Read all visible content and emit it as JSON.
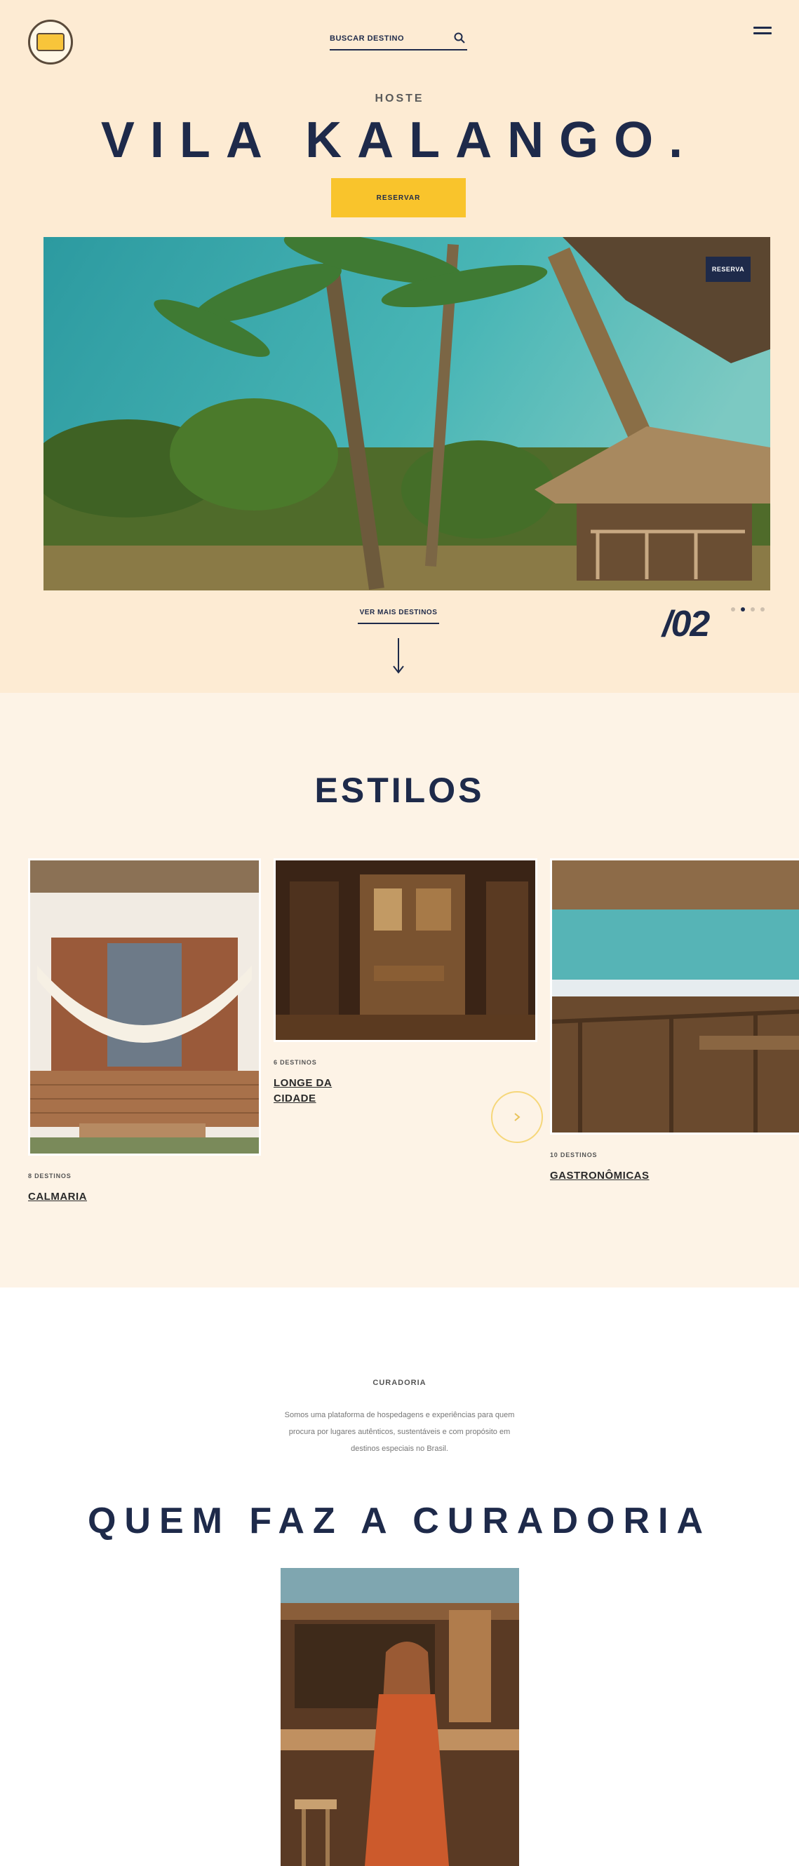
{
  "header": {
    "logo": "Vila Kalango logo",
    "search_placeholder": "BUSCAR DESTINO",
    "search_icon": "search-icon",
    "menu_icon": "hamburger-menu-icon"
  },
  "hero": {
    "eyebrow": "HOSTE",
    "title": "VILA KALANGO.",
    "cta_label": "RESERVAR",
    "photo_badge": "RESERVA",
    "see_more": "VER MAIS DESTINOS",
    "slide_number": "/02",
    "slides_total": 4,
    "slide_active": 1,
    "down_icon": "arrow-down-icon"
  },
  "styles": {
    "title": "ESTILOS",
    "cards": [
      {
        "count": "8 DESTINOS",
        "name": "CALMARIA"
      },
      {
        "count": "6 DESTINOS",
        "name": "LONGE DA CIDADE"
      },
      {
        "count": "10 DESTINOS",
        "name": "GASTRONÔMICAS"
      }
    ],
    "next_icon": "arrow-right-icon"
  },
  "curation": {
    "eyebrow": "CURADORIA",
    "text": "Somos uma plataforma de hospedagens e experiências para quem procura por lugares autênticos, sustentáveis e com propósito em destinos especiais no Brasil.",
    "title": "QUEM FAZ A CURADORIA"
  },
  "colors": {
    "navy": "#1e2a4a",
    "yellow": "#f9c42c",
    "hero_bg": "#fdebd3",
    "styles_bg": "#fdf3e6"
  }
}
